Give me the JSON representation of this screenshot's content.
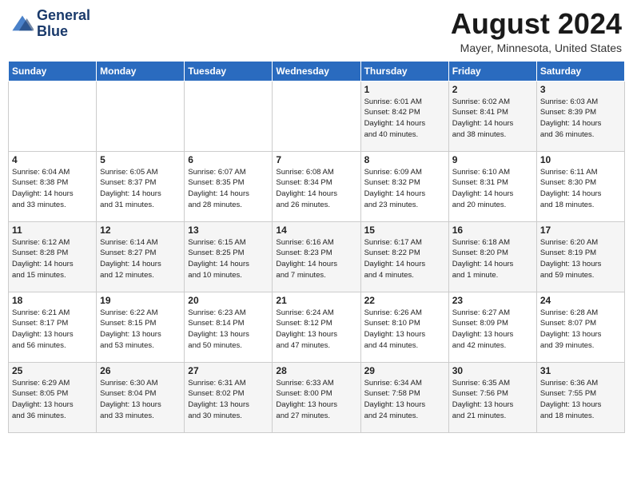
{
  "header": {
    "logo_line1": "General",
    "logo_line2": "Blue",
    "month": "August 2024",
    "location": "Mayer, Minnesota, United States"
  },
  "days_of_week": [
    "Sunday",
    "Monday",
    "Tuesday",
    "Wednesday",
    "Thursday",
    "Friday",
    "Saturday"
  ],
  "weeks": [
    [
      {
        "day": "",
        "info": ""
      },
      {
        "day": "",
        "info": ""
      },
      {
        "day": "",
        "info": ""
      },
      {
        "day": "",
        "info": ""
      },
      {
        "day": "1",
        "info": "Sunrise: 6:01 AM\nSunset: 8:42 PM\nDaylight: 14 hours\nand 40 minutes."
      },
      {
        "day": "2",
        "info": "Sunrise: 6:02 AM\nSunset: 8:41 PM\nDaylight: 14 hours\nand 38 minutes."
      },
      {
        "day": "3",
        "info": "Sunrise: 6:03 AM\nSunset: 8:39 PM\nDaylight: 14 hours\nand 36 minutes."
      }
    ],
    [
      {
        "day": "4",
        "info": "Sunrise: 6:04 AM\nSunset: 8:38 PM\nDaylight: 14 hours\nand 33 minutes."
      },
      {
        "day": "5",
        "info": "Sunrise: 6:05 AM\nSunset: 8:37 PM\nDaylight: 14 hours\nand 31 minutes."
      },
      {
        "day": "6",
        "info": "Sunrise: 6:07 AM\nSunset: 8:35 PM\nDaylight: 14 hours\nand 28 minutes."
      },
      {
        "day": "7",
        "info": "Sunrise: 6:08 AM\nSunset: 8:34 PM\nDaylight: 14 hours\nand 26 minutes."
      },
      {
        "day": "8",
        "info": "Sunrise: 6:09 AM\nSunset: 8:32 PM\nDaylight: 14 hours\nand 23 minutes."
      },
      {
        "day": "9",
        "info": "Sunrise: 6:10 AM\nSunset: 8:31 PM\nDaylight: 14 hours\nand 20 minutes."
      },
      {
        "day": "10",
        "info": "Sunrise: 6:11 AM\nSunset: 8:30 PM\nDaylight: 14 hours\nand 18 minutes."
      }
    ],
    [
      {
        "day": "11",
        "info": "Sunrise: 6:12 AM\nSunset: 8:28 PM\nDaylight: 14 hours\nand 15 minutes."
      },
      {
        "day": "12",
        "info": "Sunrise: 6:14 AM\nSunset: 8:27 PM\nDaylight: 14 hours\nand 12 minutes."
      },
      {
        "day": "13",
        "info": "Sunrise: 6:15 AM\nSunset: 8:25 PM\nDaylight: 14 hours\nand 10 minutes."
      },
      {
        "day": "14",
        "info": "Sunrise: 6:16 AM\nSunset: 8:23 PM\nDaylight: 14 hours\nand 7 minutes."
      },
      {
        "day": "15",
        "info": "Sunrise: 6:17 AM\nSunset: 8:22 PM\nDaylight: 14 hours\nand 4 minutes."
      },
      {
        "day": "16",
        "info": "Sunrise: 6:18 AM\nSunset: 8:20 PM\nDaylight: 14 hours\nand 1 minute."
      },
      {
        "day": "17",
        "info": "Sunrise: 6:20 AM\nSunset: 8:19 PM\nDaylight: 13 hours\nand 59 minutes."
      }
    ],
    [
      {
        "day": "18",
        "info": "Sunrise: 6:21 AM\nSunset: 8:17 PM\nDaylight: 13 hours\nand 56 minutes."
      },
      {
        "day": "19",
        "info": "Sunrise: 6:22 AM\nSunset: 8:15 PM\nDaylight: 13 hours\nand 53 minutes."
      },
      {
        "day": "20",
        "info": "Sunrise: 6:23 AM\nSunset: 8:14 PM\nDaylight: 13 hours\nand 50 minutes."
      },
      {
        "day": "21",
        "info": "Sunrise: 6:24 AM\nSunset: 8:12 PM\nDaylight: 13 hours\nand 47 minutes."
      },
      {
        "day": "22",
        "info": "Sunrise: 6:26 AM\nSunset: 8:10 PM\nDaylight: 13 hours\nand 44 minutes."
      },
      {
        "day": "23",
        "info": "Sunrise: 6:27 AM\nSunset: 8:09 PM\nDaylight: 13 hours\nand 42 minutes."
      },
      {
        "day": "24",
        "info": "Sunrise: 6:28 AM\nSunset: 8:07 PM\nDaylight: 13 hours\nand 39 minutes."
      }
    ],
    [
      {
        "day": "25",
        "info": "Sunrise: 6:29 AM\nSunset: 8:05 PM\nDaylight: 13 hours\nand 36 minutes."
      },
      {
        "day": "26",
        "info": "Sunrise: 6:30 AM\nSunset: 8:04 PM\nDaylight: 13 hours\nand 33 minutes."
      },
      {
        "day": "27",
        "info": "Sunrise: 6:31 AM\nSunset: 8:02 PM\nDaylight: 13 hours\nand 30 minutes."
      },
      {
        "day": "28",
        "info": "Sunrise: 6:33 AM\nSunset: 8:00 PM\nDaylight: 13 hours\nand 27 minutes."
      },
      {
        "day": "29",
        "info": "Sunrise: 6:34 AM\nSunset: 7:58 PM\nDaylight: 13 hours\nand 24 minutes."
      },
      {
        "day": "30",
        "info": "Sunrise: 6:35 AM\nSunset: 7:56 PM\nDaylight: 13 hours\nand 21 minutes."
      },
      {
        "day": "31",
        "info": "Sunrise: 6:36 AM\nSunset: 7:55 PM\nDaylight: 13 hours\nand 18 minutes."
      }
    ]
  ]
}
